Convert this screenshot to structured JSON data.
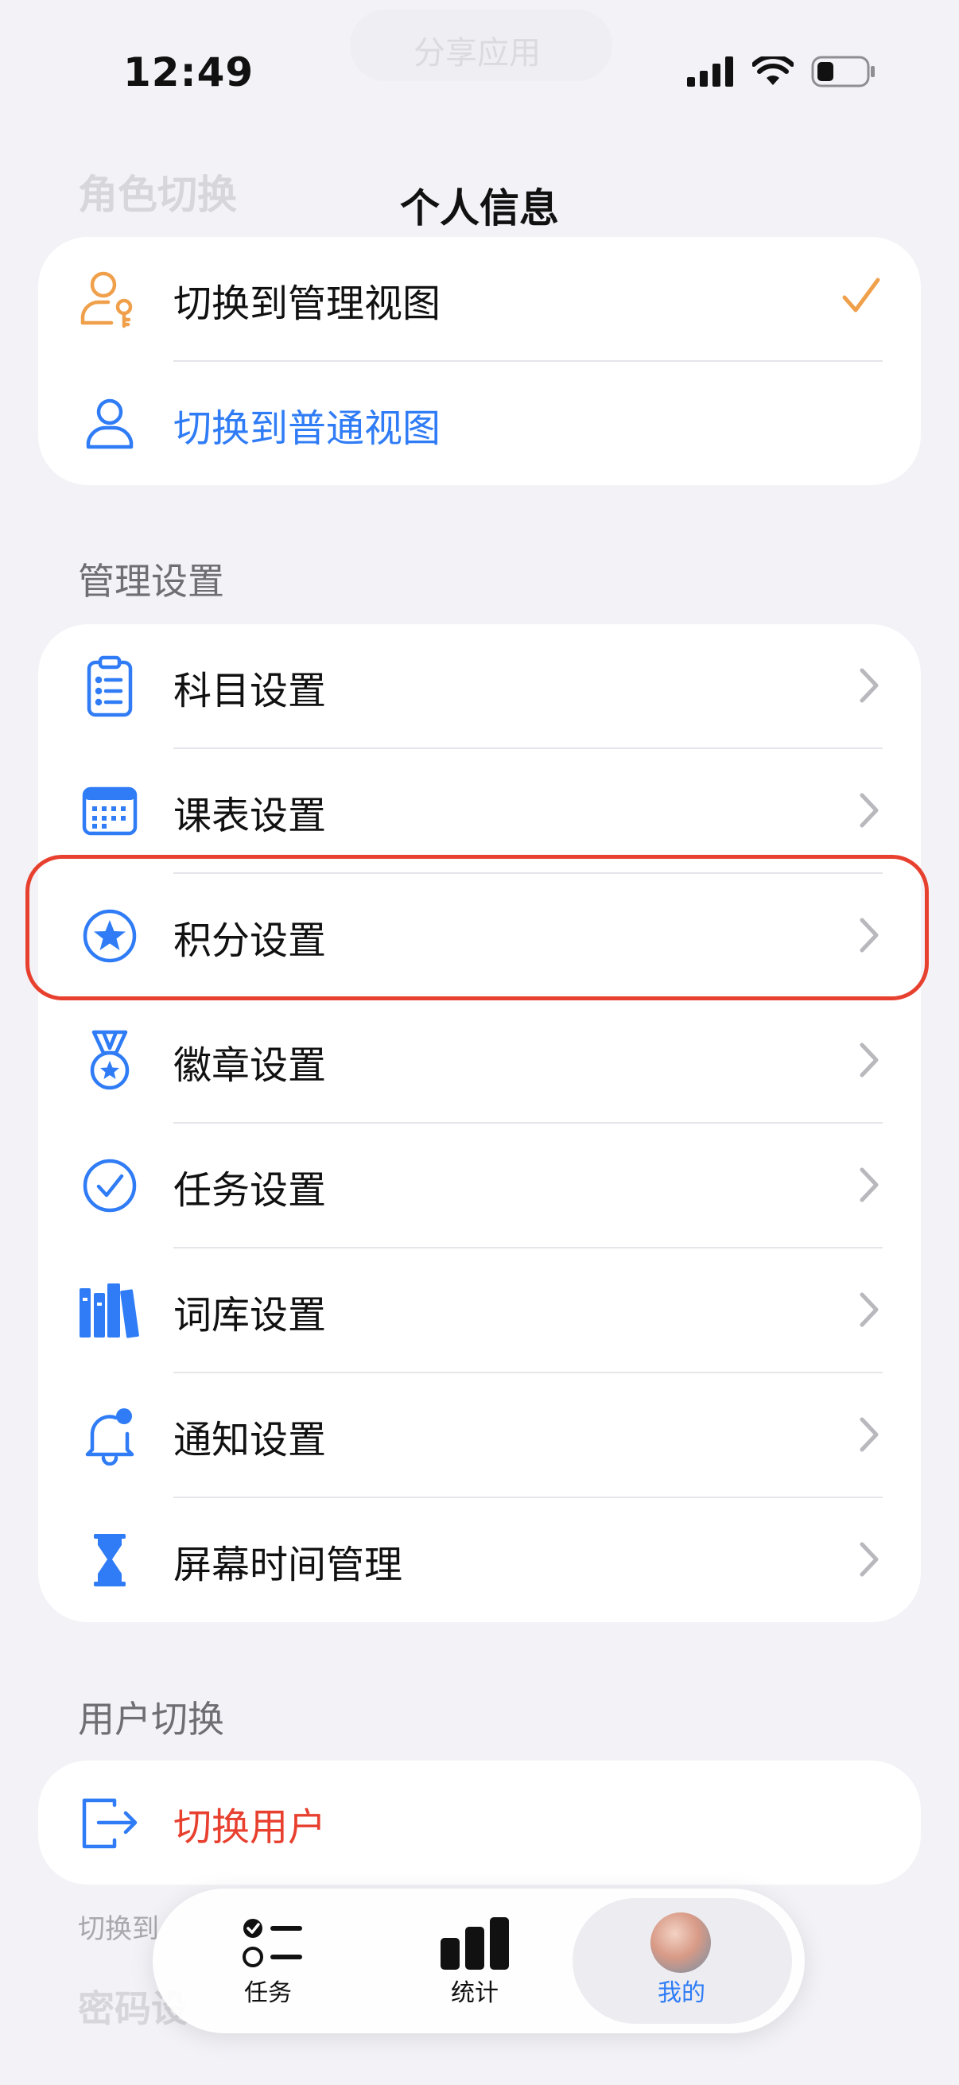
{
  "status_bar": {
    "time": "12:49"
  },
  "ghost": {
    "top_pill": "分享应用",
    "section_role": "角色切换",
    "hint": "切换到",
    "section_password": "密码设"
  },
  "nav": {
    "title": "个人信息"
  },
  "role_switch": {
    "items": [
      {
        "label": "切换到管理视图",
        "icon": "admin-user-icon",
        "checked": true
      },
      {
        "label": "切换到普通视图",
        "icon": "user-icon"
      }
    ]
  },
  "management": {
    "header": "管理设置",
    "items": [
      {
        "label": "科目设置",
        "icon": "clipboard-list-icon"
      },
      {
        "label": "课表设置",
        "icon": "calendar-icon"
      },
      {
        "label": "积分设置",
        "icon": "star-circle-icon",
        "highlighted": true
      },
      {
        "label": "徽章设置",
        "icon": "medal-icon"
      },
      {
        "label": "任务设置",
        "icon": "check-circle-icon"
      },
      {
        "label": "词库设置",
        "icon": "books-icon"
      },
      {
        "label": "通知设置",
        "icon": "bell-badge-icon"
      },
      {
        "label": "屏幕时间管理",
        "icon": "hourglass-icon"
      }
    ]
  },
  "user_switch": {
    "header": "用户切换",
    "item": {
      "label": "切换用户",
      "icon": "logout-icon"
    }
  },
  "tabbar": {
    "tabs": [
      {
        "label": "任务",
        "icon": "task-list-icon"
      },
      {
        "label": "统计",
        "icon": "bar-chart-icon"
      },
      {
        "label": "我的",
        "icon": "avatar",
        "active": true
      }
    ]
  },
  "colors": {
    "accent": "#2f7cf6",
    "orange": "#f0a04b",
    "danger": "#e8402f",
    "highlight_border": "#e8402f"
  }
}
